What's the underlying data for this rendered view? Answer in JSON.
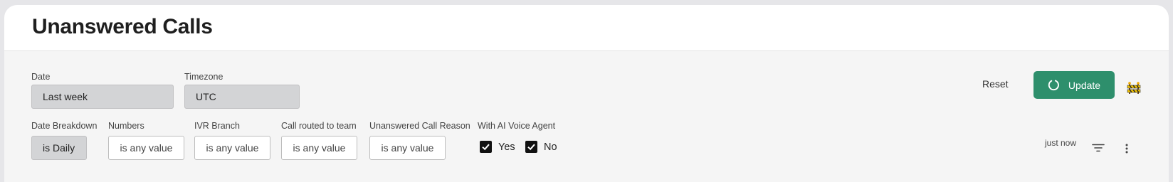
{
  "page": {
    "title": "Unanswered Calls"
  },
  "filters": {
    "date": {
      "label": "Date",
      "value": "Last week"
    },
    "timezone": {
      "label": "Timezone",
      "value": "UTC"
    },
    "date_breakdown": {
      "label": "Date Breakdown",
      "value": "is Daily"
    },
    "numbers": {
      "label": "Numbers",
      "value": "is any value"
    },
    "ivr_branch": {
      "label": "IVR Branch",
      "value": "is any value"
    },
    "call_routed_to_team": {
      "label": "Call routed to team",
      "value": "is any value"
    },
    "unanswered_call_reason": {
      "label": "Unanswered Call Reason",
      "value": "is any value"
    },
    "with_ai_voice_agent": {
      "label": "With AI Voice Agent",
      "options": [
        {
          "label": "Yes",
          "checked": true
        },
        {
          "label": "No",
          "checked": true
        }
      ]
    }
  },
  "toolbar": {
    "reset_label": "Reset",
    "update_label": "Update",
    "last_updated": "just now"
  },
  "icons": {
    "update": "refresh-icon",
    "construction": "roadblock-icon",
    "filter": "filter-lines-icon",
    "more": "more-vertical-icon"
  },
  "colors": {
    "accent": "#2e8f6c"
  }
}
